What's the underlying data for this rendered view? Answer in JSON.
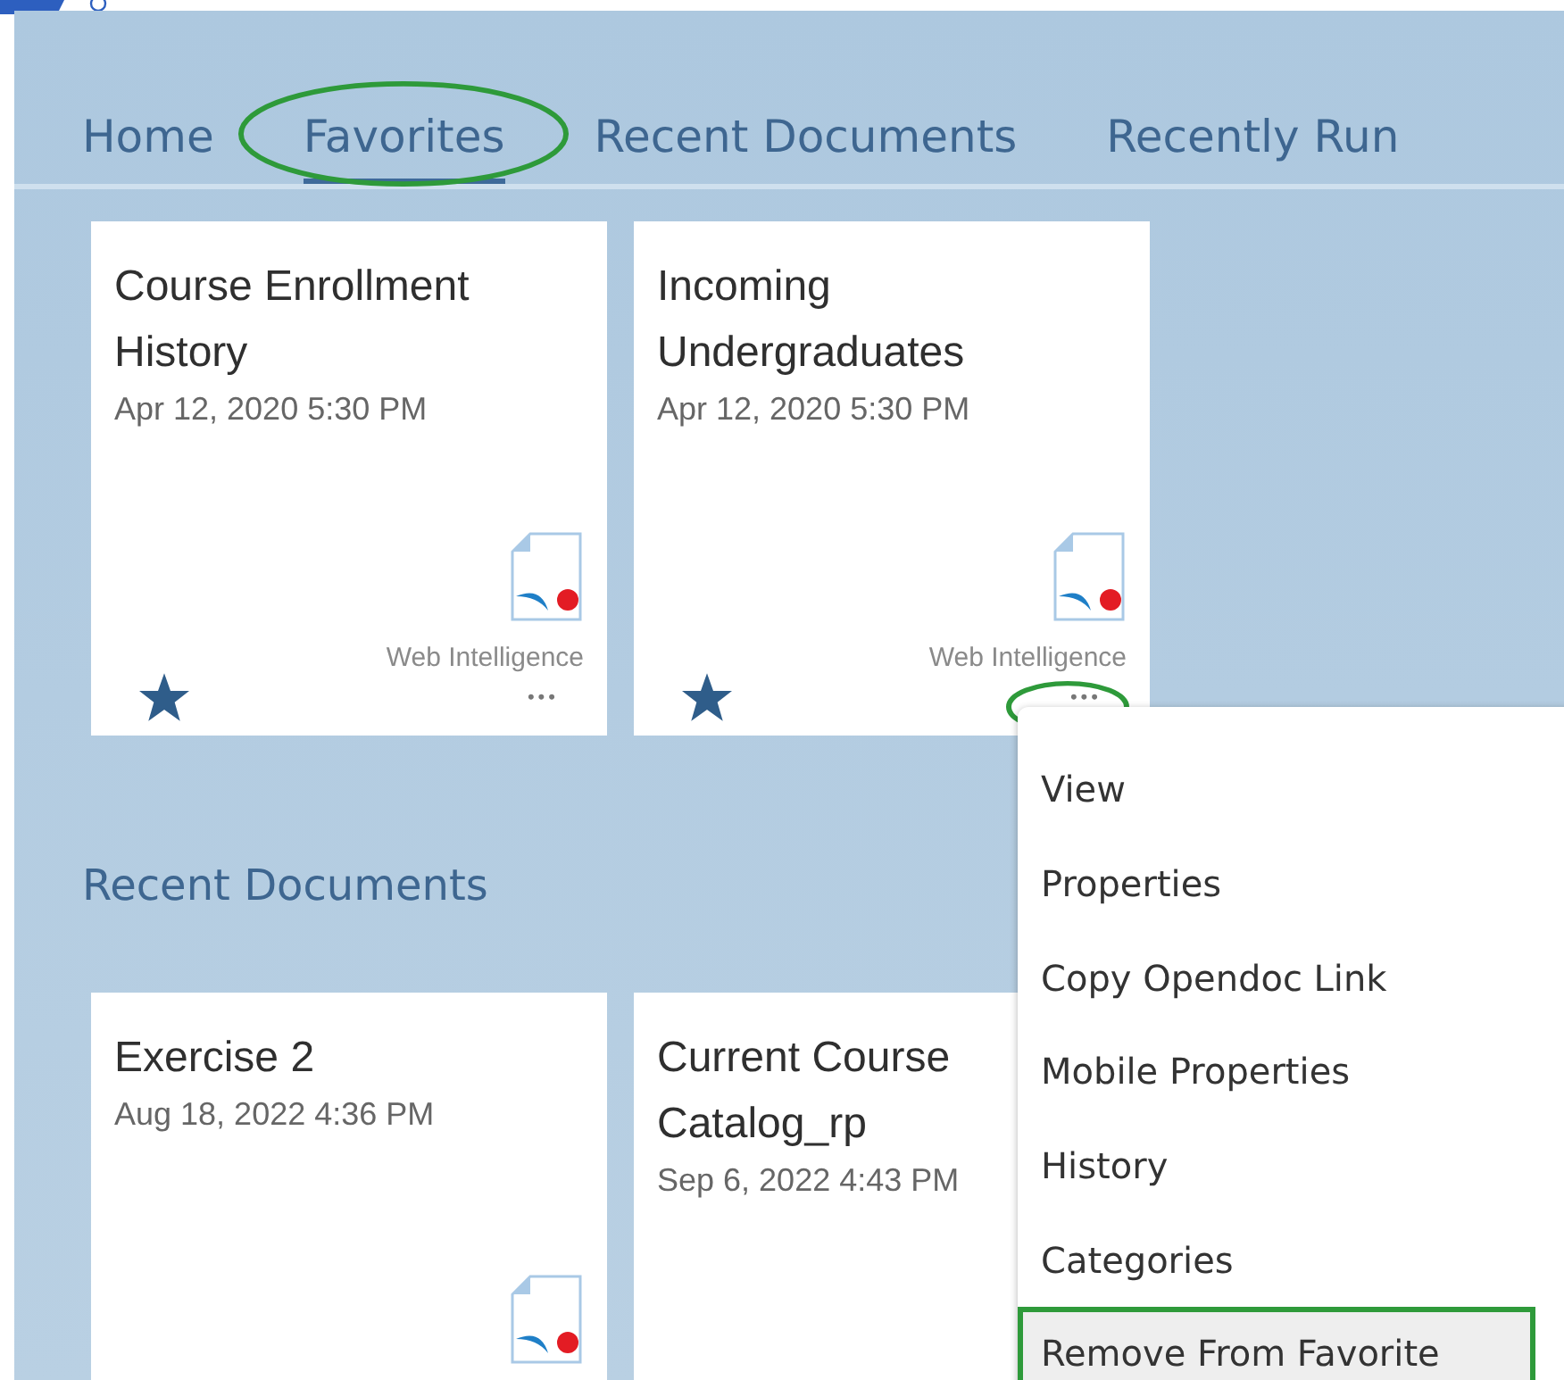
{
  "tabs": [
    {
      "label": "Home",
      "selected": false,
      "circled": false
    },
    {
      "label": "Favorites",
      "selected": true,
      "circled": true
    },
    {
      "label": "Recent Documents",
      "selected": false,
      "circled": false
    },
    {
      "label": "Recently Run",
      "selected": false,
      "circled": false
    }
  ],
  "favorites": [
    {
      "title": "Course Enrollment History",
      "date": "Apr 12, 2020 5:30 PM",
      "type_label": "Web Intelligence",
      "favorite": true,
      "more": "•••",
      "more_circled": false
    },
    {
      "title": "Incoming Undergraduates",
      "date": "Apr 12, 2020 5:30 PM",
      "type_label": "Web Intelligence",
      "favorite": true,
      "more": "•••",
      "more_circled": true
    }
  ],
  "recent_section": {
    "title": "Recent Documents",
    "cards": [
      {
        "title": "Exercise 2",
        "date": "Aug 18, 2022 4:36 PM"
      },
      {
        "title": "Current Course Catalog_rp",
        "date": "Sep 6, 2022 4:43 PM"
      }
    ]
  },
  "context_menu": [
    {
      "label": "View",
      "hovered": false
    },
    {
      "label": "Properties",
      "hovered": false
    },
    {
      "label": "Copy Opendoc Link",
      "hovered": false
    },
    {
      "label": "Mobile Properties",
      "hovered": false
    },
    {
      "label": "History",
      "hovered": false
    },
    {
      "label": "Categories",
      "hovered": false
    },
    {
      "label": "Remove From Favorite",
      "hovered": true
    }
  ]
}
